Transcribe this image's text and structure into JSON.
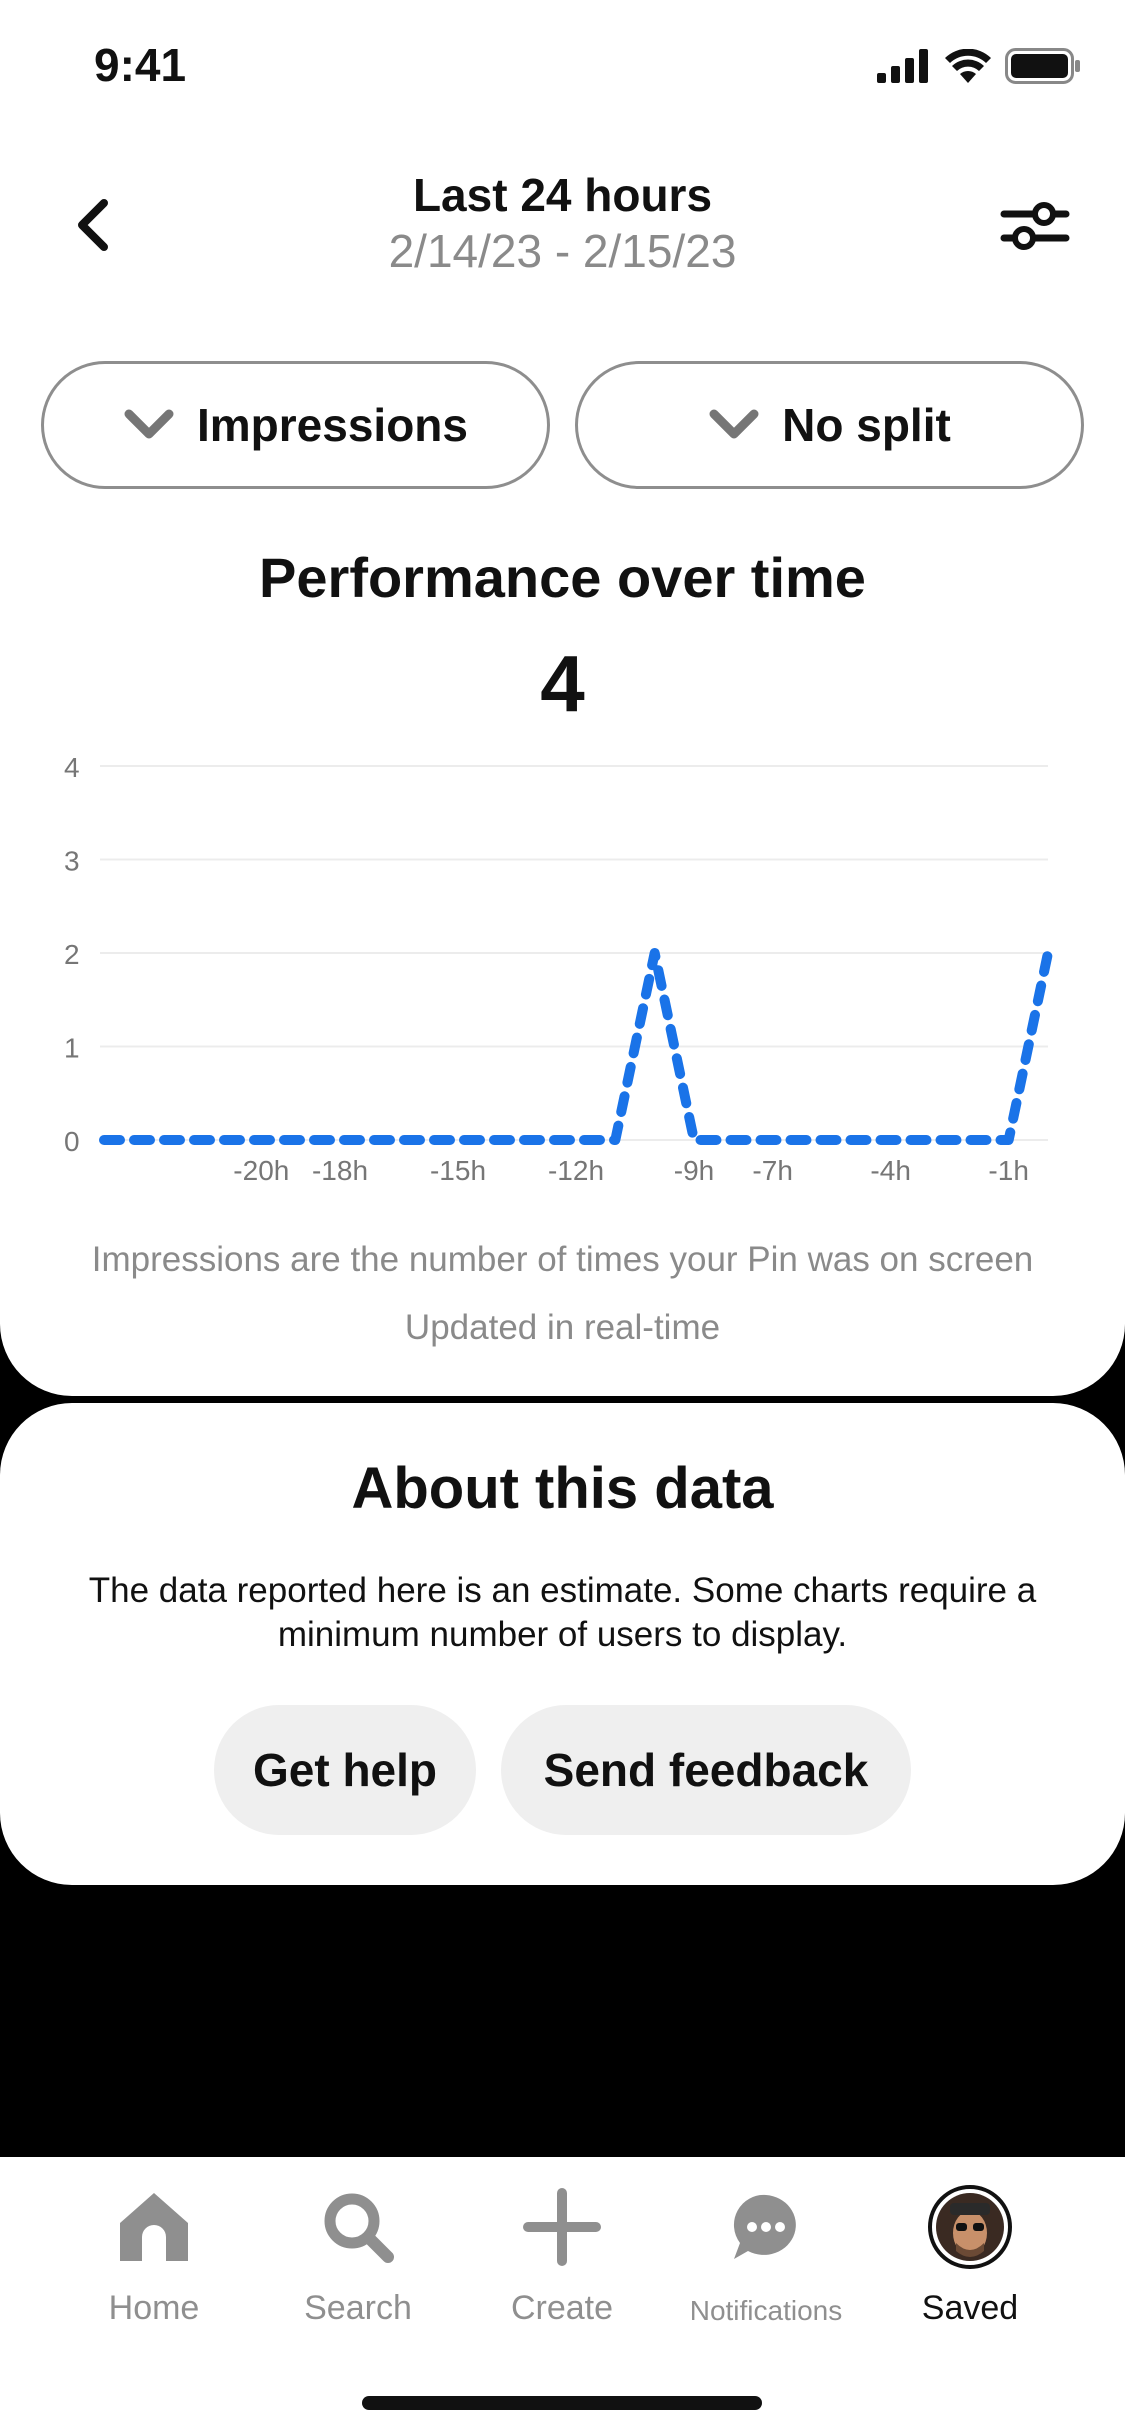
{
  "status": {
    "time": "9:41"
  },
  "header": {
    "title": "Last 24 hours",
    "subtitle": "2/14/23 - 2/15/23"
  },
  "filters": {
    "metric_label": "Impressions",
    "split_label": "No split"
  },
  "performance": {
    "title": "Performance over time",
    "total": "4",
    "note": "Impressions are the number of times your Pin was on screen",
    "updated": "Updated in real-time"
  },
  "chart_data": {
    "type": "line",
    "x": [
      -24,
      -23,
      -22,
      -21,
      -20,
      -19,
      -18,
      -17,
      -16,
      -15,
      -14,
      -13,
      -12,
      -11,
      -10,
      -9,
      -8,
      -7,
      -6,
      -5,
      -4,
      -3,
      -2,
      -1,
      0
    ],
    "series": [
      {
        "values": [
          0,
          0,
          0,
          0,
          0,
          0,
          0,
          0,
          0,
          0,
          0,
          0,
          0,
          0,
          2,
          0,
          0,
          0,
          0,
          0,
          0,
          0,
          0,
          0,
          2
        ]
      }
    ],
    "ylim": [
      0,
      4
    ],
    "y_ticks": [
      "0",
      "1",
      "2",
      "3",
      "4"
    ],
    "x_ticks": [
      {
        "x": -20,
        "label": "-20h"
      },
      {
        "x": -18,
        "label": "-18h"
      },
      {
        "x": -15,
        "label": "-15h"
      },
      {
        "x": -12,
        "label": "-12h"
      },
      {
        "x": -9,
        "label": "-9h"
      },
      {
        "x": -7,
        "label": "-7h"
      },
      {
        "x": -4,
        "label": "-4h"
      },
      {
        "x": -1,
        "label": "-1h"
      }
    ],
    "line_color": "#1a73e8",
    "line_style": "dashed",
    "grid": true
  },
  "about": {
    "title": "About this data",
    "body": "The data reported here is an estimate. Some charts require a minimum number of users to display.",
    "help_label": "Get help",
    "feedback_label": "Send feedback"
  },
  "tabs": [
    {
      "label": "Home",
      "icon": "home-icon"
    },
    {
      "label": "Search",
      "icon": "search-icon"
    },
    {
      "label": "Create",
      "icon": "plus-icon"
    },
    {
      "label": "Notifications",
      "icon": "chat-bubble-icon"
    },
    {
      "label": "Saved",
      "icon": "avatar",
      "active": true
    }
  ]
}
